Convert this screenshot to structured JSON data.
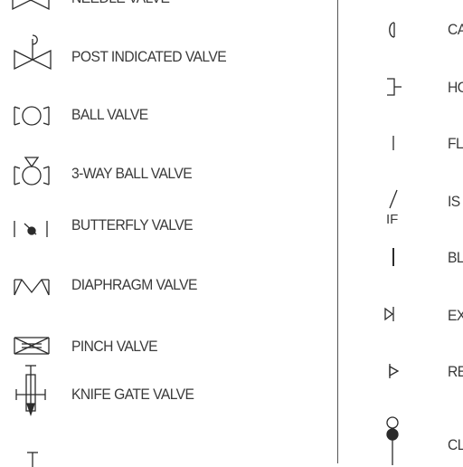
{
  "left_column": [
    {
      "id": "needle",
      "label": "NEEDLE VALVE",
      "icon": "needle-valve-icon"
    },
    {
      "id": "post-indicated",
      "label": "POST INDICATED VALVE",
      "icon": "post-indicated-valve-icon"
    },
    {
      "id": "ball",
      "label": "BALL VALVE",
      "icon": "ball-valve-icon"
    },
    {
      "id": "three-way-ball",
      "label": "3-WAY BALL VALVE",
      "icon": "three-way-ball-valve-icon"
    },
    {
      "id": "butterfly",
      "label": "BUTTERFLY VALVE",
      "icon": "butterfly-valve-icon"
    },
    {
      "id": "diaphragm",
      "label": "DIAPHRAGM VALVE",
      "icon": "diaphragm-valve-icon"
    },
    {
      "id": "pinch",
      "label": "PINCH VALVE",
      "icon": "pinch-valve-icon"
    },
    {
      "id": "knife-gate",
      "label": "KNIFE GATE VALVE",
      "icon": "knife-gate-valve-icon"
    }
  ],
  "right_column": [
    {
      "id": "ca",
      "label": "CA",
      "icon": "cap-icon"
    },
    {
      "id": "ho",
      "label": "HO",
      "icon": "hose-connection-icon"
    },
    {
      "id": "fl",
      "label": "FL",
      "icon": "flange-icon"
    },
    {
      "id": "is",
      "label": "IS",
      "icon": "insulating-flange-icon",
      "sub_label": "IF"
    },
    {
      "id": "bl",
      "label": "BL",
      "icon": "blind-flange-icon"
    },
    {
      "id": "ex",
      "label": "EX",
      "icon": "expansion-joint-icon"
    },
    {
      "id": "re",
      "label": "RE",
      "icon": "reducer-icon"
    },
    {
      "id": "cl",
      "label": "CL",
      "icon": "cleanout-icon"
    }
  ]
}
